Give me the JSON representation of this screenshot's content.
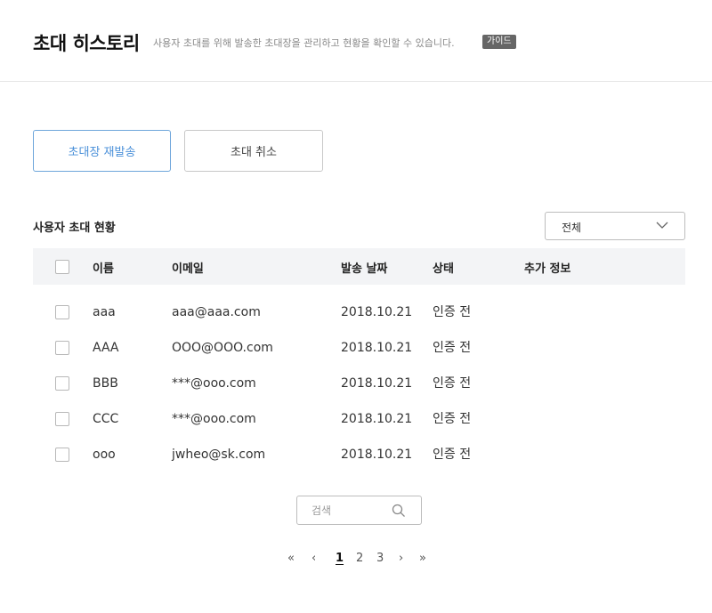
{
  "header": {
    "title": "초대 히스토리",
    "subtitle": "사용자 초대를 위해 발송한 초대장을 관리하고 현황을 확인할 수 있습니다.",
    "guide_badge": "가이드"
  },
  "actions": {
    "resend_label": "초대장 재발송",
    "cancel_label": "초대 취소"
  },
  "section": {
    "title": "사용자 초대 현황",
    "filter_value": "전체"
  },
  "table": {
    "columns": [
      "이름",
      "이메일",
      "발송 날짜",
      "상태",
      "추가 정보"
    ],
    "rows": [
      {
        "name": "aaa",
        "email": "aaa@aaa.com",
        "date": "2018.10.21",
        "status": "인증 전"
      },
      {
        "name": "AAA",
        "email": "OOO@OOO.com",
        "date": "2018.10.21",
        "status": "인증 전"
      },
      {
        "name": "BBB",
        "email": "***@ooo.com",
        "date": "2018.10.21",
        "status": "인증 전"
      },
      {
        "name": "CCC",
        "email": "***@ooo.com",
        "date": "2018.10.21",
        "status": "인증 전"
      },
      {
        "name": "ooo",
        "email": "jwheo@sk.com",
        "date": "2018.10.21",
        "status": "인증 전"
      }
    ]
  },
  "search": {
    "placeholder": "검색",
    "icon": "search-icon"
  },
  "pagination": {
    "first": "«",
    "prev": "‹",
    "pages": [
      "1",
      "2",
      "3"
    ],
    "current": "1",
    "next": "›",
    "last": "»"
  },
  "colors": {
    "accent": "#4a90d9",
    "header_bg": "#f3f4f6",
    "badge_bg": "#666666"
  }
}
